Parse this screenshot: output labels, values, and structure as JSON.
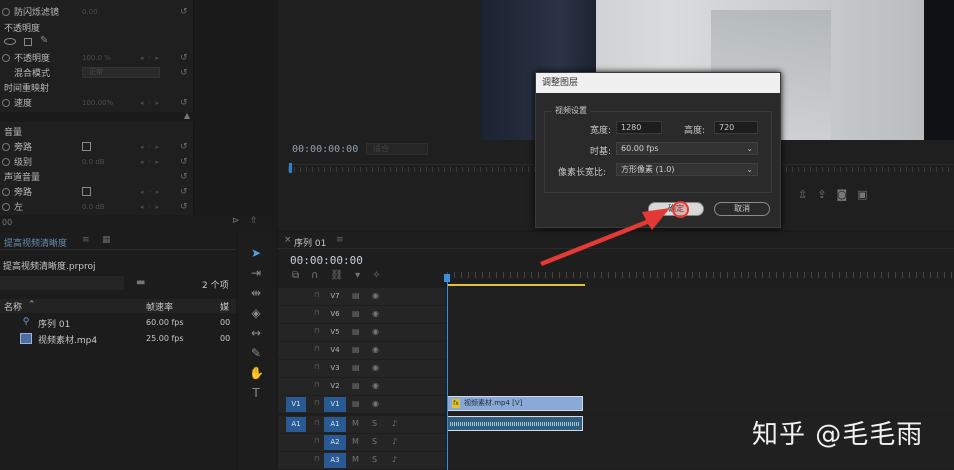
{
  "effect_controls": {
    "rows": [
      {
        "label": "防闪烁滤镜",
        "value": "0.00"
      },
      {
        "label": "不透明度"
      },
      {
        "label": "不透明度",
        "value": "100.0 %"
      },
      {
        "label": "混合模式",
        "value": "正常"
      },
      {
        "label": "时间重映射"
      },
      {
        "label": "速度",
        "value": "100.00%"
      },
      {
        "label": "音量"
      },
      {
        "label": "旁路"
      },
      {
        "label": "级别",
        "value": "0.0 dB"
      },
      {
        "label": "声道音量"
      },
      {
        "label": "旁路"
      },
      {
        "label": "左",
        "value": "0.0 dB"
      }
    ],
    "footer_timecode": "00"
  },
  "program_monitor": {
    "timecode": "00:00:00:00",
    "fit_dropdown": "适合"
  },
  "dialog": {
    "title": "调整图层",
    "group_label": "视频设置",
    "width_label": "宽度:",
    "width_value": "1280",
    "height_label": "高度:",
    "height_value": "720",
    "timebase_label": "时基:",
    "timebase_value": "60.00 fps",
    "par_label": "像素长宽比:",
    "par_value": "方形像素 (1.0)",
    "ok_label": "确定",
    "cancel_label": "取消"
  },
  "project": {
    "tab_label": "提高视频清晰度",
    "project_file": "提高视频清晰度.prproj",
    "item_count": "2 个项",
    "columns": {
      "name": "名称",
      "fps": "帧速率",
      "media": "媒"
    },
    "items": [
      {
        "name": "序列 01",
        "fps": "60.00 fps",
        "media": "00",
        "icon": "sequence-icon"
      },
      {
        "name": "视频素材.mp4",
        "fps": "25.00 fps",
        "media": "00",
        "icon": "video-clip-icon"
      }
    ]
  },
  "timeline": {
    "tab_label": "序列 01",
    "timecode": "00:00:00:00",
    "video_tracks": [
      "V7",
      "V6",
      "V5",
      "V4",
      "V3",
      "V2",
      "V1"
    ],
    "audio_tracks": [
      "A1",
      "A2",
      "A3"
    ],
    "video_source_target": "V1",
    "audio_source_target": "A1",
    "video_clip_label": "视频素材.mp4 [V]",
    "fx_badge": "fx"
  },
  "watermark": "知乎 @毛毛雨",
  "colors": {
    "accent_blue": "#2a5a93",
    "work_area_yellow": "#e0c531",
    "annotation_red": "#e53935",
    "video_clip": "#8aa9d6",
    "audio_clip": "#2f5f7a"
  }
}
